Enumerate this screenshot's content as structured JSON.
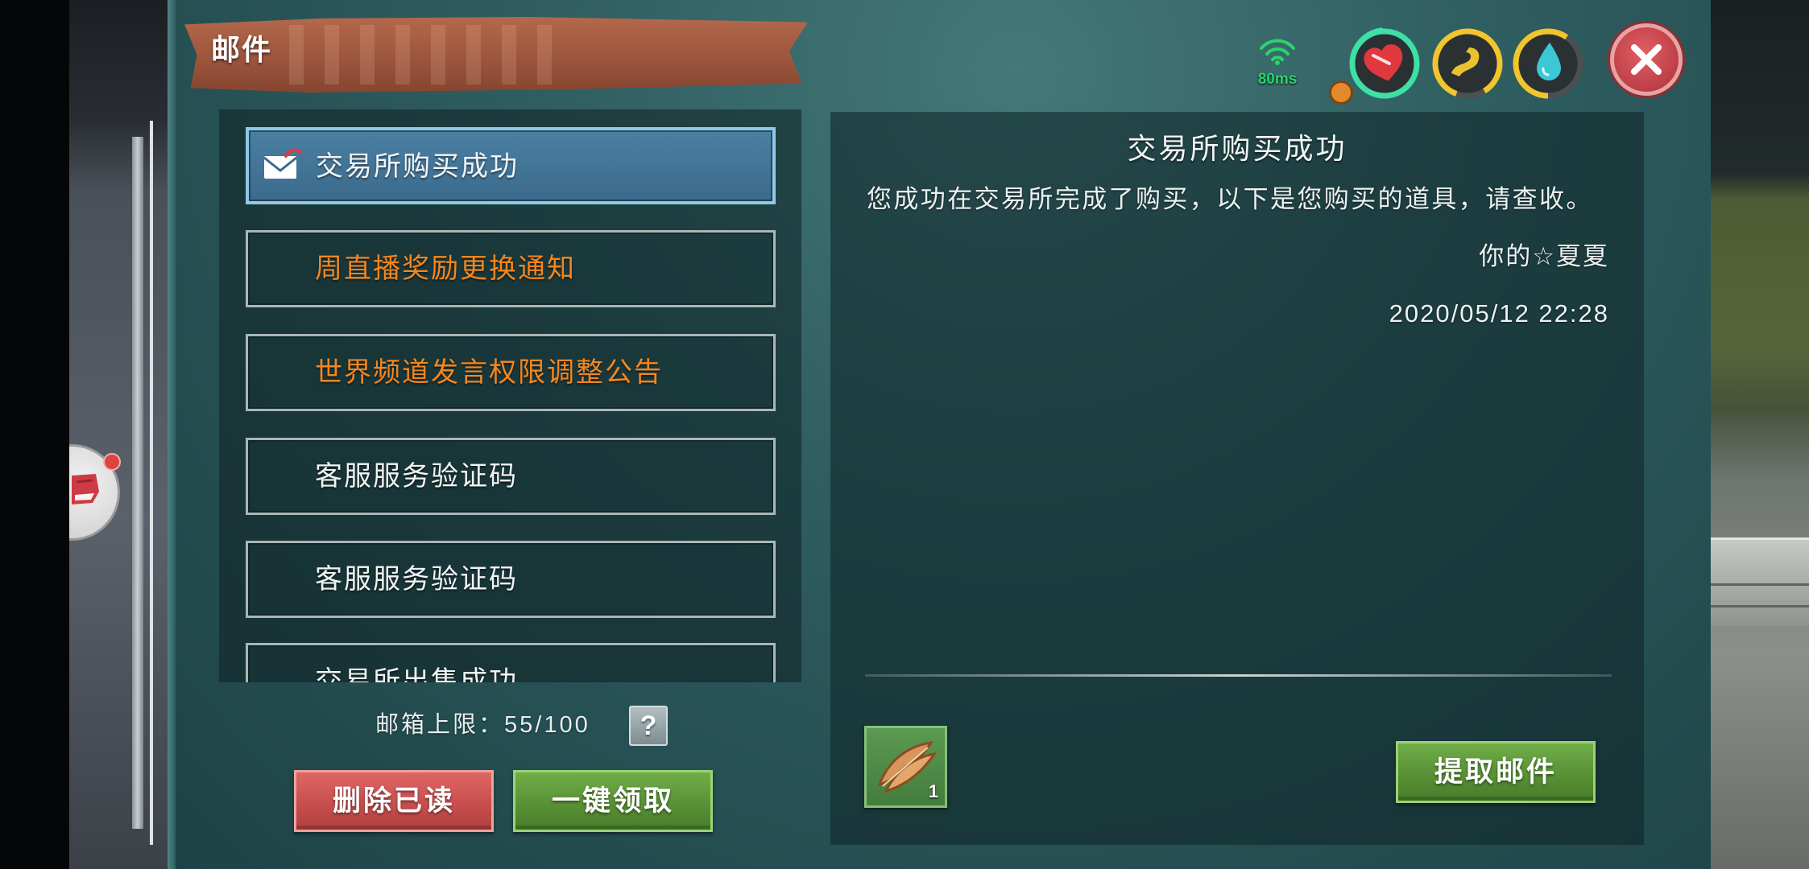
{
  "window": {
    "title": "邮件"
  },
  "network": {
    "ping": "80ms",
    "icon": "wifi-signal-icon"
  },
  "hud": {
    "health": {
      "icon": "heart-icon",
      "ring_color": "#3ee0a4"
    },
    "stamina": {
      "icon": "stamina-icon",
      "ring_color": "#f1c62c"
    },
    "thirst": {
      "icon": "water-drop-icon",
      "ring_color": "#f1c62c"
    },
    "close": {
      "icon": "close-icon"
    }
  },
  "mail_list": {
    "items": [
      {
        "title": "交易所购买成功",
        "selected": true,
        "icon": "mail-unread-icon",
        "color": "#f2f4f4"
      },
      {
        "title": "周直播奖励更换通知",
        "selected": false,
        "color": "#f5861f"
      },
      {
        "title": "世界频道发言权限调整公告",
        "selected": false,
        "color": "#f5861f"
      },
      {
        "title": "客服服务验证码",
        "selected": false,
        "color": "#f2f4f4"
      },
      {
        "title": "客服服务验证码",
        "selected": false,
        "color": "#f2f4f4"
      },
      {
        "title": "交易所出售成功",
        "selected": false,
        "color": "#f2f4f4"
      }
    ]
  },
  "mailbox": {
    "limit_label": "邮箱上限：",
    "limit_value": "55/100",
    "help_label": "?"
  },
  "actions": {
    "delete_read": "删除已读",
    "claim_all": "一键领取"
  },
  "mail_detail": {
    "subject": "交易所购买成功",
    "body": "您成功在交易所完成了购买，以下是您购买的道具，请查收。",
    "signature": "你的☆夏夏",
    "timestamp": "2020/05/12 22:28",
    "attachments": [
      {
        "icon": "feather-item-icon",
        "count": "1"
      }
    ],
    "claim_label": "提取邮件"
  },
  "colors": {
    "panel": "#2f5d60",
    "selected_item": "#3d6f92",
    "unread_orange": "#f5861f",
    "button_red": "#c64d4d",
    "button_green": "#578f34",
    "ping_green": "#2bd46b"
  }
}
